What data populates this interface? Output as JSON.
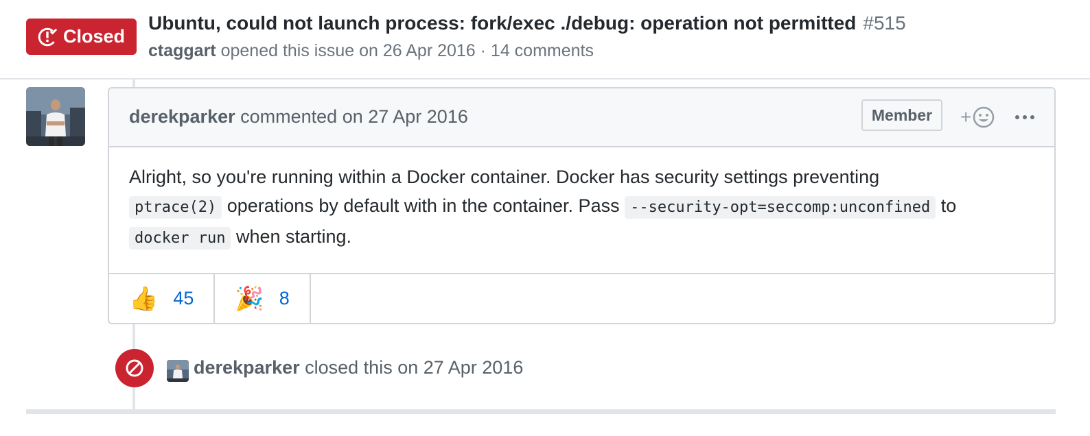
{
  "issue": {
    "state": "Closed",
    "title": "Ubuntu, could not launch process: fork/exec ./debug: operation not permitted",
    "number": "#515",
    "author": "ctaggart",
    "meta_text": "opened this issue on 26 Apr 2016 · 14 comments"
  },
  "comment": {
    "author": "derekparker",
    "action": "commented on 27 Apr 2016",
    "badge": "Member",
    "add_reaction_icon": "smiley-icon",
    "body": {
      "p1": "Alright, so you're running within a Docker container. Docker has security settings preventing",
      "code1": "ptrace(2)",
      "p2": "operations by default with in the container. Pass",
      "code2": "--security-opt=seccomp:unconfined",
      "p3": "to",
      "code3": "docker run",
      "p4": "when starting."
    },
    "reactions": [
      {
        "emoji": "👍",
        "count": "45"
      },
      {
        "emoji": "🎉",
        "count": "8"
      }
    ]
  },
  "event": {
    "actor": "derekparker",
    "text": "closed this on 27 Apr 2016"
  },
  "colors": {
    "closed_red": "#cb2431",
    "link_blue": "#0366d6",
    "muted": "#586069",
    "border": "#d1d5da"
  }
}
